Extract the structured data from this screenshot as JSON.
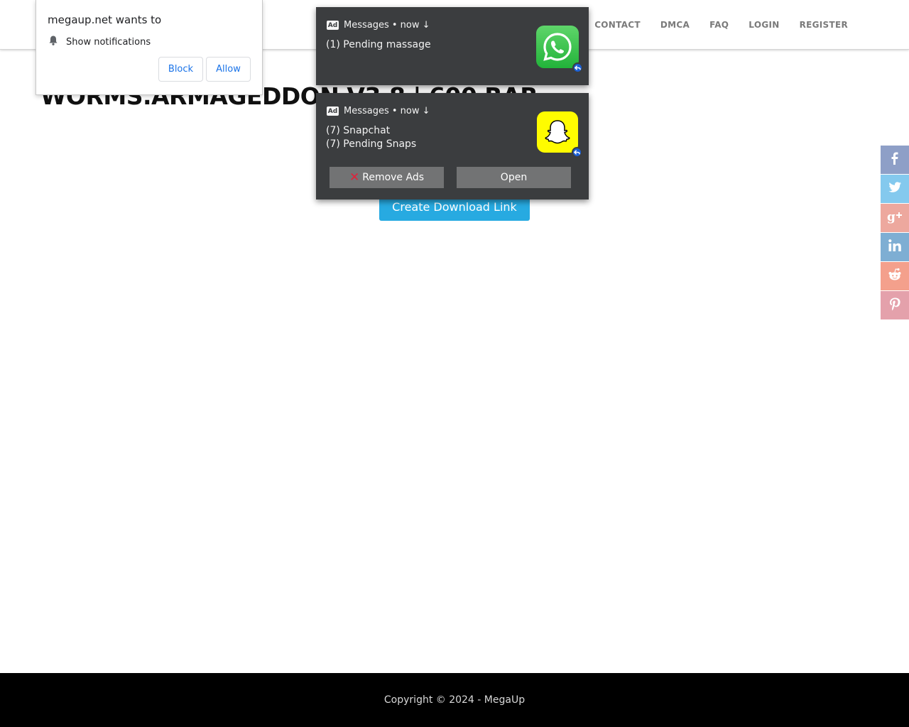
{
  "nav": {
    "items": [
      {
        "label": "CONTACT"
      },
      {
        "label": "DMCA"
      },
      {
        "label": "FAQ"
      },
      {
        "label": "LOGIN"
      },
      {
        "label": "REGISTER"
      }
    ]
  },
  "page": {
    "title": "WORMS.ARMAGEDDON V3.8 | 600 RAR",
    "download_label": "Create Download Link"
  },
  "permission": {
    "title": "megaup.net wants to",
    "request": "Show notifications",
    "block_label": "Block",
    "allow_label": "Allow"
  },
  "notifications": [
    {
      "header": "Messages • now ↓",
      "badge": "Ad",
      "lines": [
        "(1) Pending massage"
      ],
      "icon": "whatsapp-icon"
    },
    {
      "header": "Messages • now ↓",
      "badge": "Ad",
      "lines": [
        "(7) Snapchat",
        "(7) Pending Snaps"
      ],
      "icon": "snapchat-icon",
      "remove_label": "Remove Ads",
      "open_label": "Open"
    }
  ],
  "social": [
    {
      "name": "facebook-icon",
      "color": "#8e9fc7"
    },
    {
      "name": "twitter-icon",
      "color": "#84c9ee"
    },
    {
      "name": "google-plus-icon",
      "color": "#eda89e"
    },
    {
      "name": "linkedin-icon",
      "color": "#7eaed3"
    },
    {
      "name": "reddit-icon",
      "color": "#f4a08c"
    },
    {
      "name": "pinterest-icon",
      "color": "#e4a1ab"
    }
  ],
  "footer": {
    "copyright": "Copyright © 2024 - MegaUp"
  },
  "colors": {
    "download_button": "#27aae1",
    "notification_bg": "#3b3d3f",
    "footer_bg": "#000000"
  }
}
